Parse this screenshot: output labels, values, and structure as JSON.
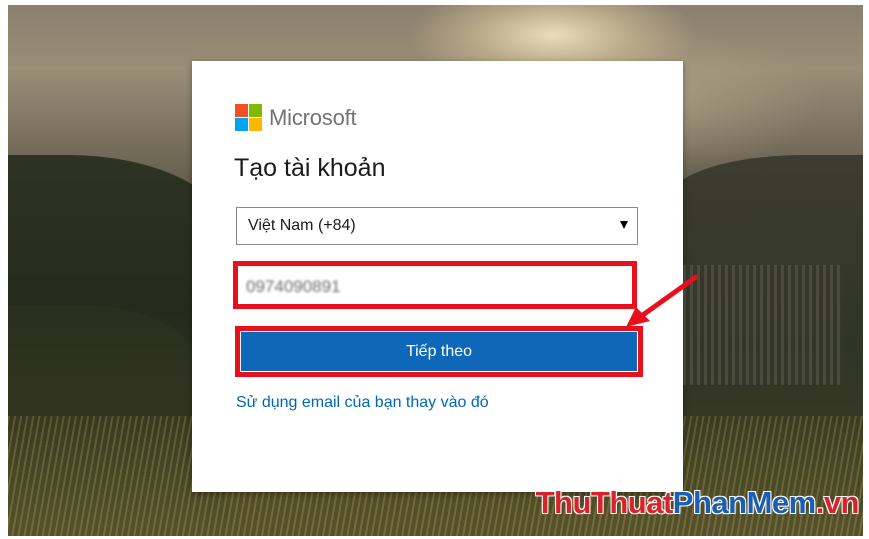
{
  "brand": {
    "logo_colors": [
      "#f25022",
      "#7fba00",
      "#00a4ef",
      "#ffb900"
    ],
    "name": "Microsoft"
  },
  "form": {
    "title": "Tạo tài khoản",
    "country_select": {
      "selected": "Việt Nam (+84)",
      "arrow_icon": "caret-down-icon"
    },
    "phone_field": {
      "value": "0974090891",
      "blurred": true
    },
    "next_button": {
      "label": "Tiếp theo",
      "color": "#0f67b9"
    },
    "alt_link": "Sử dụng email của bạn thay vào đó"
  },
  "annotations": {
    "highlight_color": "#e8101c",
    "arrow_icon": "red-arrow-pointer-icon"
  },
  "watermark": {
    "part1": "ThuThuat",
    "part2": "PhanMem",
    "part3": ".vn",
    "colors": [
      "#d8232a",
      "#1a5fb4"
    ]
  }
}
